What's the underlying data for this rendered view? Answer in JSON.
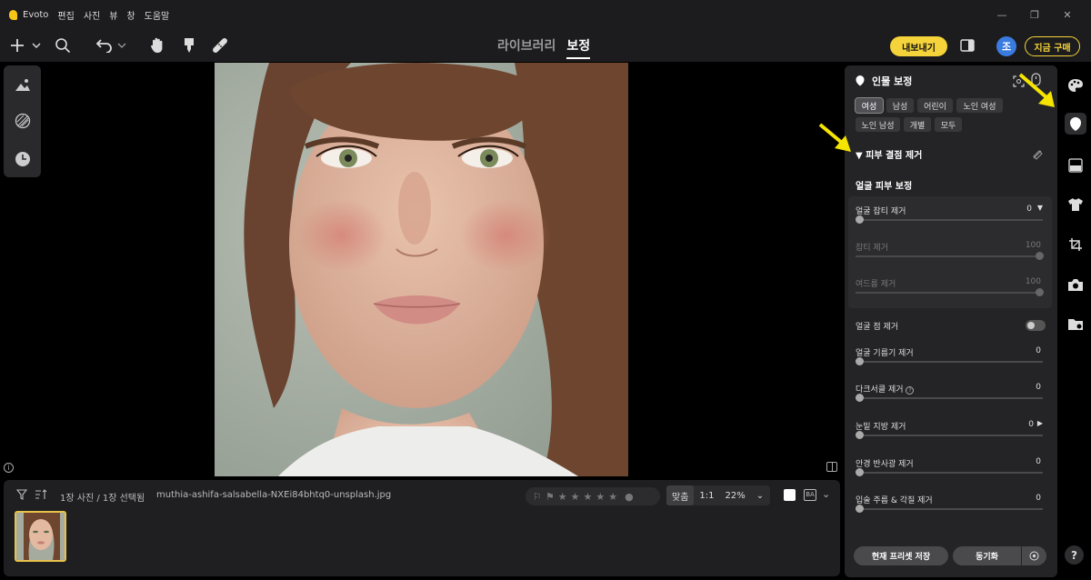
{
  "menubar": {
    "app_name": "Evoto",
    "items": [
      "편집",
      "사진",
      "뷰",
      "창",
      "도움말"
    ]
  },
  "toolbar": {
    "tabs": [
      "라이브러리",
      "보정"
    ],
    "active_tab": "보정",
    "export_label": "내보내기",
    "avatar_initial": "조",
    "buy_label": "지금 구매",
    "accent_color": "#f5d33a"
  },
  "filmstrip": {
    "count_text": "1장 사진 / 1장 선택됨",
    "filename": "muthia-ashifa-salsabella-NXEi84bhtq0-unsplash.jpg",
    "zoom_options": [
      "맞춤",
      "1:1"
    ],
    "zoom_value": "22%",
    "rating_stars": 5
  },
  "panel": {
    "title": "인물 보정",
    "chips": [
      "여성",
      "남성",
      "어린이",
      "노인 여성",
      "노인 남성",
      "개별",
      "모두"
    ],
    "selected_chip": "여성",
    "section_title": "피부 결점 제거",
    "subsection_title": "얼굴 피부 보정",
    "group_sliders": [
      {
        "label": "얼굴 잡티 제거",
        "value": "0",
        "level": 0
      },
      {
        "label": "잡티 제거",
        "value": "100",
        "level": 100
      },
      {
        "label": "여드름 제거",
        "value": "100",
        "level": 100
      }
    ],
    "toggle_label": "얼굴 점 제거",
    "sliders": [
      {
        "label": "얼굴 기름기 제거",
        "value": "0",
        "level": 0
      },
      {
        "label": "다크서클 제거",
        "value": "0",
        "level": 0
      },
      {
        "label": "눈밑 지방 제거",
        "value": "0",
        "level": 0
      },
      {
        "label": "안경 반사광 제거",
        "value": "0",
        "level": 0
      },
      {
        "label": "입술 주름 & 각질 제거",
        "value": "0",
        "level": 0
      }
    ],
    "save_preset_label": "현재 프리셋 저장",
    "sync_label": "동기화"
  },
  "right_icons": [
    "palette-icon",
    "face-icon",
    "gradient-icon",
    "shirt-icon",
    "crop-icon",
    "camera-icon",
    "folder-icon"
  ],
  "help_label": "?"
}
